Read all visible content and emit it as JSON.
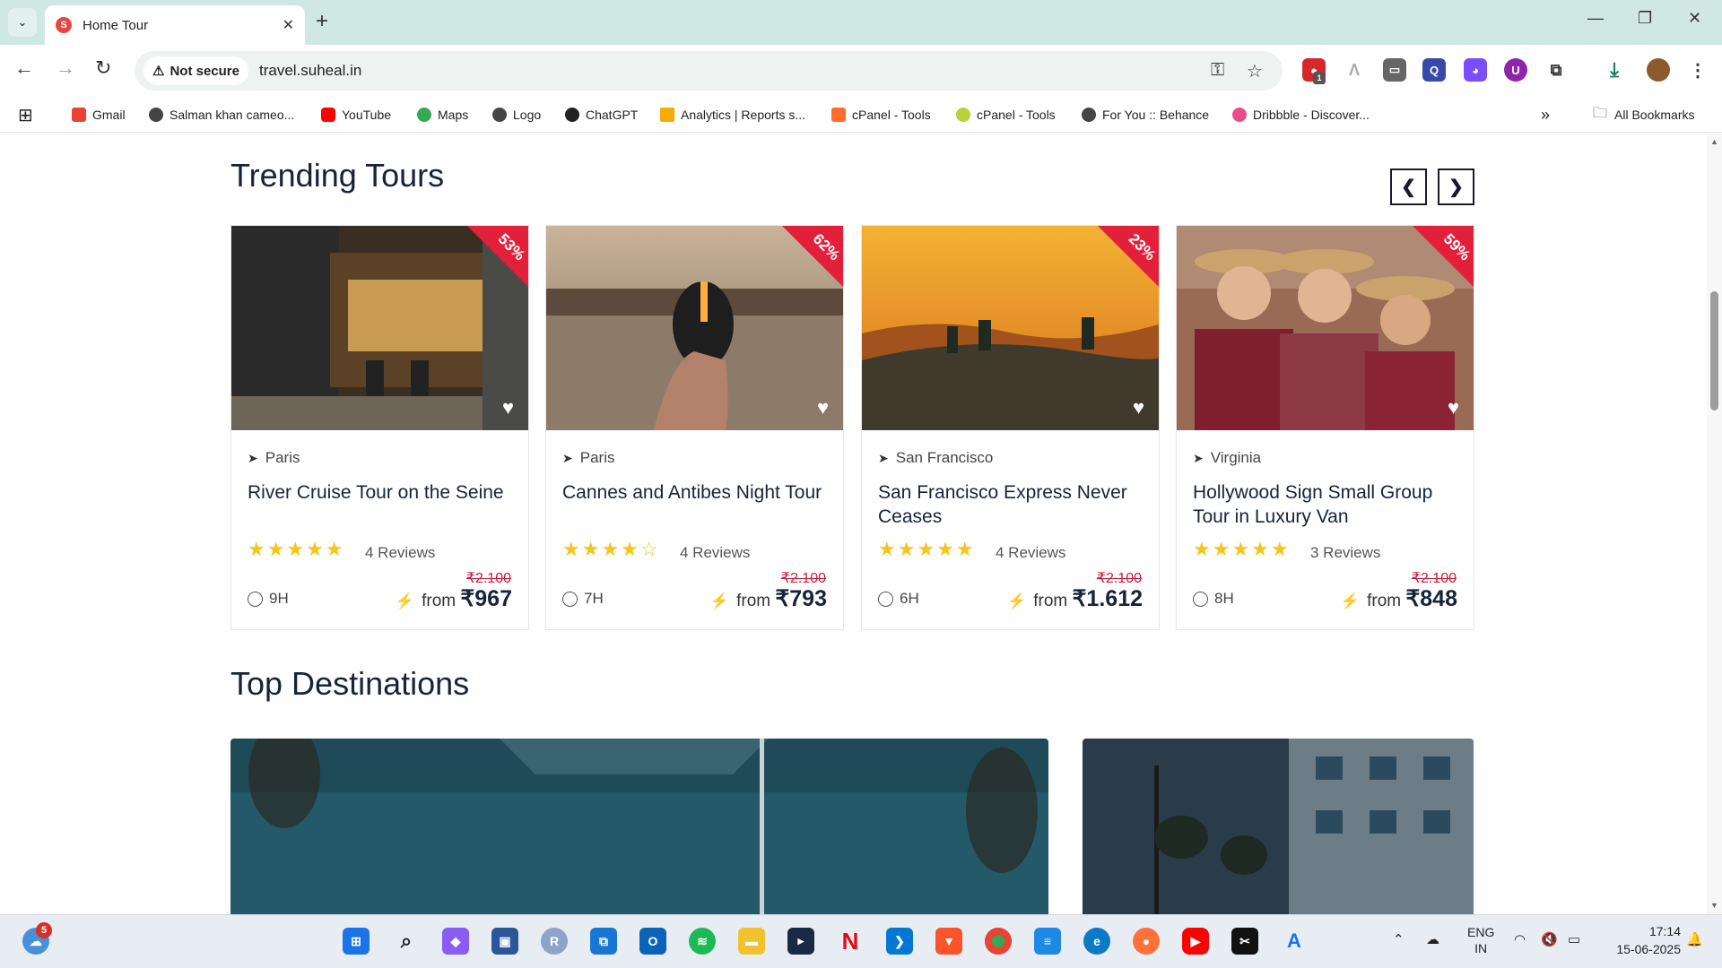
{
  "browser": {
    "tab_title": "Home Tour",
    "new_tab": "+",
    "minimize": "—",
    "restore": "❐",
    "close": "✕",
    "not_secure": "Not secure",
    "url": "travel.suheal.in",
    "bookmarks": [
      "Gmail",
      "Salman khan cameo...",
      "YouTube",
      "Maps",
      "Logo",
      "ChatGPT",
      "Analytics | Reports s...",
      "cPanel - Tools",
      "cPanel - Tools",
      "For You :: Behance",
      "Dribbble - Discover..."
    ],
    "more_bookmarks": "»",
    "all_bookmarks": "All Bookmarks",
    "extension_badge": "1"
  },
  "trending": {
    "title": "Trending Tours",
    "prev": "❮",
    "next": "❯",
    "cards": [
      {
        "discount": "53%",
        "location": "Paris",
        "title": "River Cruise Tour on the Seine",
        "rating": 5,
        "stars": "★★★★★",
        "reviews": "4 Reviews",
        "duration": "9H",
        "old_price": "₹2.100",
        "price": "₹967",
        "from": "from"
      },
      {
        "discount": "62%",
        "location": "Paris",
        "title": "Cannes and Antibes Night Tour",
        "rating": 4,
        "stars": "★★★★☆",
        "reviews": "4 Reviews",
        "duration": "7H",
        "old_price": "₹2.100",
        "price": "₹793",
        "from": "from"
      },
      {
        "discount": "23%",
        "location": "San Francisco",
        "title": "San Francisco Express Never Ceases",
        "rating": 5,
        "stars": "★★★★★",
        "reviews": "4 Reviews",
        "duration": "6H",
        "old_price": "₹2.100",
        "price": "₹1.612",
        "from": "from"
      },
      {
        "discount": "59%",
        "location": "Virginia",
        "title": "Hollywood Sign Small Group Tour in Luxury Van",
        "rating": 5,
        "stars": "★★★★★",
        "reviews": "3 Reviews",
        "duration": "8H",
        "old_price": "₹2.100",
        "price": "₹848",
        "from": "from"
      }
    ]
  },
  "destinations": {
    "title": "Top Destinations"
  },
  "taskbar": {
    "weather_badge": "5",
    "lang": "ENG",
    "region": "IN",
    "time": "17:14",
    "date": "15-06-2025"
  },
  "colors": {
    "accent": "#e3203a",
    "star": "#f5c518",
    "heading": "#17233a"
  }
}
